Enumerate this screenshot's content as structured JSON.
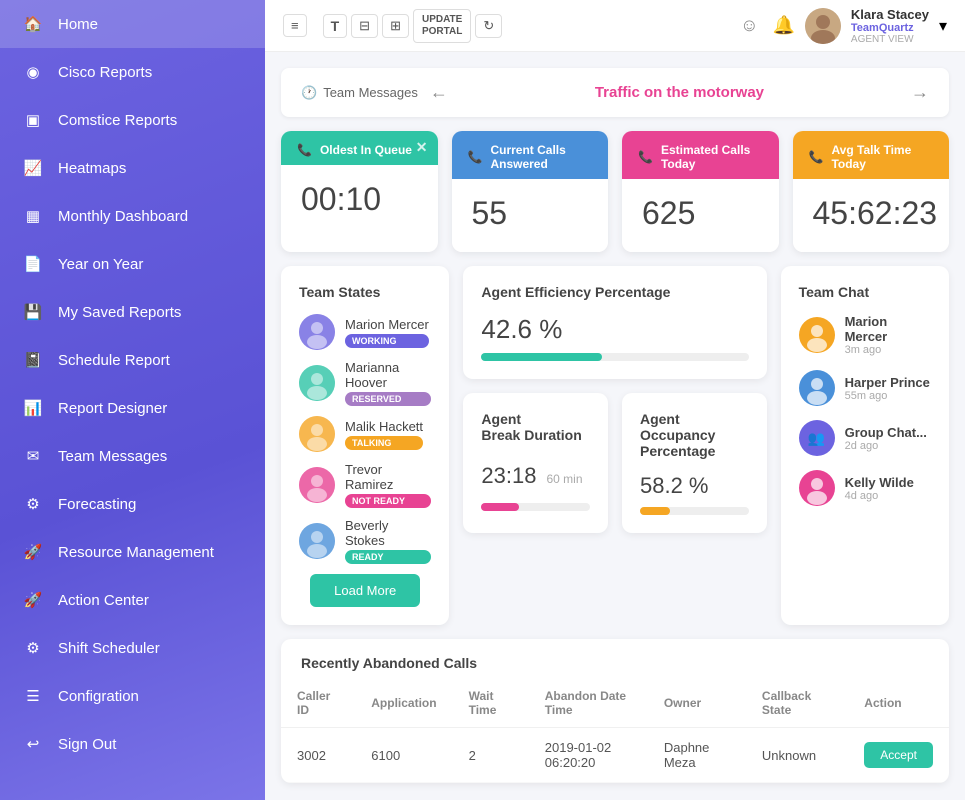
{
  "sidebar": {
    "items": [
      {
        "id": "home",
        "label": "Home",
        "icon": "🏠"
      },
      {
        "id": "cisco-reports",
        "label": "Cisco Reports",
        "icon": "📊"
      },
      {
        "id": "comstice-reports",
        "label": "Comstice Reports",
        "icon": "📋"
      },
      {
        "id": "heatmaps",
        "label": "Heatmaps",
        "icon": "📈"
      },
      {
        "id": "monthly-dashboard",
        "label": "Monthly Dashboard",
        "icon": "📅"
      },
      {
        "id": "year-on-year",
        "label": "Year on Year",
        "icon": "📄"
      },
      {
        "id": "my-saved-reports",
        "label": "My Saved Reports",
        "icon": "💾"
      },
      {
        "id": "schedule-report",
        "label": "Schedule Report",
        "icon": "📓"
      },
      {
        "id": "report-designer",
        "label": "Report Designer",
        "icon": "📊"
      },
      {
        "id": "team-messages",
        "label": "Team Messages",
        "icon": "✉️"
      },
      {
        "id": "forecasting",
        "label": "Forecasting",
        "icon": "⚙️"
      },
      {
        "id": "resource-management",
        "label": "Resource Management",
        "icon": "🚀"
      },
      {
        "id": "action-center",
        "label": "Action Center",
        "icon": "🚀"
      },
      {
        "id": "shift-scheduler",
        "label": "Shift Scheduler",
        "icon": "⚙️"
      },
      {
        "id": "configuration",
        "label": "Configration",
        "icon": "☰"
      },
      {
        "id": "sign-out",
        "label": "Sign Out",
        "icon": "↩"
      }
    ]
  },
  "topbar": {
    "hamburger_label": "≡",
    "tool_increase": "T↑",
    "tool_decrease": "T-",
    "tool_add": "T+",
    "update_portal": "UPDATE\nPORTAL",
    "refresh": "↻",
    "user": {
      "name": "Klara Stacey",
      "org": "TeamQuartz",
      "role": "AGENT VIEW"
    }
  },
  "team_messages": {
    "label": "Team Messages",
    "nav_prev": "←",
    "nav_next": "→",
    "message": "Traffic on the motorway"
  },
  "stat_cards": [
    {
      "id": "oldest-in-queue",
      "title": "Oldest In Queue",
      "value": "00:10",
      "color": "card-green",
      "has_close": true
    },
    {
      "id": "current-calls-answered",
      "title": "Current Calls Answered",
      "value": "55",
      "color": "card-blue",
      "has_close": false
    },
    {
      "id": "estimated-calls-today",
      "title": "Estimated Calls Today",
      "value": "625",
      "color": "card-pink",
      "has_close": false
    },
    {
      "id": "avg-talk-time-today",
      "title": "Avg Talk Time Today",
      "value": "45:62:23",
      "color": "card-yellow",
      "has_close": false
    }
  ],
  "team_states": {
    "title": "Team States",
    "agents": [
      {
        "name": "Marion Mercer",
        "status": "WORKING",
        "badge": "badge-working"
      },
      {
        "name": "Marianna Hoover",
        "status": "RESERVED",
        "badge": "badge-reserved"
      },
      {
        "name": "Malik Hackett",
        "status": "TALKING",
        "badge": "badge-talking"
      },
      {
        "name": "Trevor Ramirez",
        "status": "NOT READY",
        "badge": "badge-notready"
      },
      {
        "name": "Beverly Stokes",
        "status": "READY",
        "badge": "badge-ready"
      }
    ],
    "load_more": "Load More"
  },
  "agent_efficiency": {
    "title": "Agent Efficiency Percentage",
    "value": "42.6 %",
    "fill_width": 45,
    "break_duration": {
      "title": "Agent\nBreak Duration",
      "value": "23:18",
      "unit": "60 min",
      "fill_width": 35
    },
    "occupancy": {
      "title": "Agent\nOccupancy Percentage",
      "value": "58.2 %",
      "fill_width": 28
    }
  },
  "team_chat": {
    "title": "Team Chat",
    "members": [
      {
        "name": "Marion Mercer",
        "time": "3m ago",
        "color": "av-orange"
      },
      {
        "name": "Harper Prince",
        "time": "55m ago",
        "color": "av-blue"
      },
      {
        "name": "Group Chat...",
        "time": "2d ago",
        "color": "av-purple"
      },
      {
        "name": "Kelly Wilde",
        "time": "4d ago",
        "color": "av-pink"
      }
    ]
  },
  "abandoned_calls": {
    "title": "Recently Abandoned Calls",
    "columns": [
      "Caller ID",
      "Application",
      "Wait Time",
      "Abandon Date Time",
      "Owner",
      "Callback State",
      "Action"
    ],
    "rows": [
      {
        "caller_id": "3002",
        "application": "6100",
        "wait_time": "2",
        "abandon_date": "2019-01-02\n06:20:20",
        "owner": "Daphne Meza",
        "callback_state": "Unknown",
        "action": "Accept"
      }
    ]
  }
}
